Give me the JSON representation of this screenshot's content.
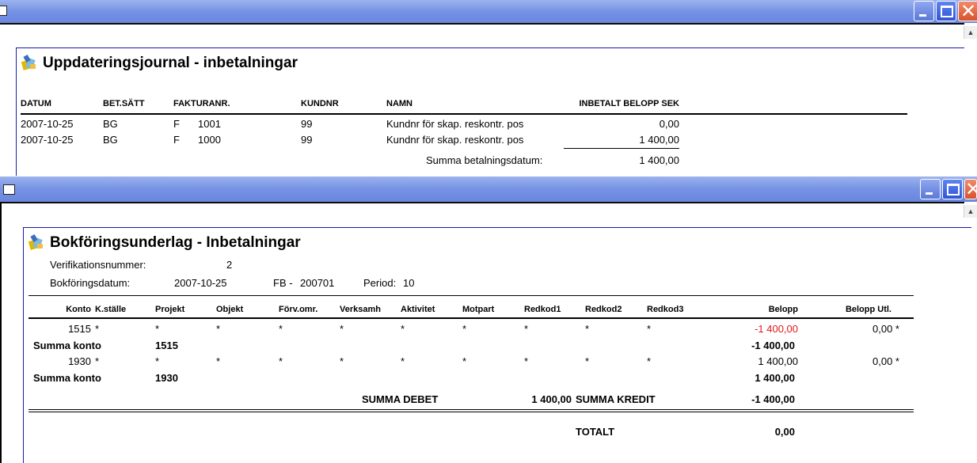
{
  "window1": {
    "title": "Uppdateringsjournal - inbetalningar",
    "headers": {
      "datum": "DATUM",
      "betsatt": "BET.SÄTT",
      "fakturanr": "FAKTURANR.",
      "kundnr": "KUNDNR",
      "namn": "NAMN",
      "belopp": "INBETALT BELOPP SEK"
    },
    "rows": [
      {
        "datum": "2007-10-25",
        "betsatt": "BG",
        "typ": "F",
        "fakturanr": "1001",
        "kundnr": "99",
        "namn": "Kundnr för skap. reskontr. pos",
        "belopp": "0,00"
      },
      {
        "datum": "2007-10-25",
        "betsatt": "BG",
        "typ": "F",
        "fakturanr": "1000",
        "kundnr": "99",
        "namn": "Kundnr för skap. reskontr. pos",
        "belopp": "1 400,00"
      }
    ],
    "summa_label": "Summa betalningsdatum:",
    "summa_value": "1 400,00"
  },
  "window2": {
    "title": "Bokföringsunderlag - Inbetalningar",
    "verifikation_label": "Verifikationsnummer:",
    "verifikation_value": "2",
    "bokforing_label": "Bokföringsdatum:",
    "bokforing_value": "2007-10-25",
    "fb_label": "FB -",
    "fb_value": "200701",
    "period_label": "Period:",
    "period_value": "10",
    "headers": {
      "konto": "Konto",
      "kstalle": "K.ställe",
      "projekt": "Projekt",
      "objekt": "Objekt",
      "forvomr": "Förv.omr.",
      "verksamh": "Verksamh",
      "aktivitet": "Aktivitet",
      "motpart": "Motpart",
      "redkod1": "Redkod1",
      "redkod2": "Redkod2",
      "redkod3": "Redkod3",
      "belopp": "Belopp",
      "belopp_utl": "Belopp Utl."
    },
    "rows": [
      {
        "konto": "1515",
        "kstalle": "*",
        "projekt": "*",
        "objekt": "*",
        "forvomr": "*",
        "verksamh": "*",
        "aktivitet": "*",
        "motpart": "*",
        "redkod1": "*",
        "redkod2": "*",
        "redkod3": "*",
        "belopp": "-1 400,00",
        "belopp_utl": "0,00 *"
      },
      {
        "konto": "1930",
        "kstalle": "*",
        "projekt": "*",
        "objekt": "*",
        "forvomr": "*",
        "verksamh": "*",
        "aktivitet": "*",
        "motpart": "*",
        "redkod1": "*",
        "redkod2": "*",
        "redkod3": "*",
        "belopp": "1 400,00",
        "belopp_utl": "0,00 *"
      }
    ],
    "summa_konto_label": "Summa konto",
    "summa_konto_1": {
      "konto": "1515",
      "belopp": "-1 400,00"
    },
    "summa_konto_2": {
      "konto": "1930",
      "belopp": "1 400,00"
    },
    "summa_debet_label": "SUMMA DEBET",
    "summa_debet_value": "1 400,00",
    "summa_kredit_label": "SUMMA KREDIT",
    "summa_kredit_value": "-1 400,00",
    "totalt_label": "TOTALT",
    "totalt_value": "0,00"
  },
  "colors": {
    "titlebar": "#7592e4",
    "negative": "#e01818",
    "frame": "#1a1aaa"
  },
  "icons": [
    "window-icon",
    "minimize-icon",
    "maximize-icon",
    "close-icon",
    "report-logo-icon",
    "scroll-up-icon"
  ]
}
